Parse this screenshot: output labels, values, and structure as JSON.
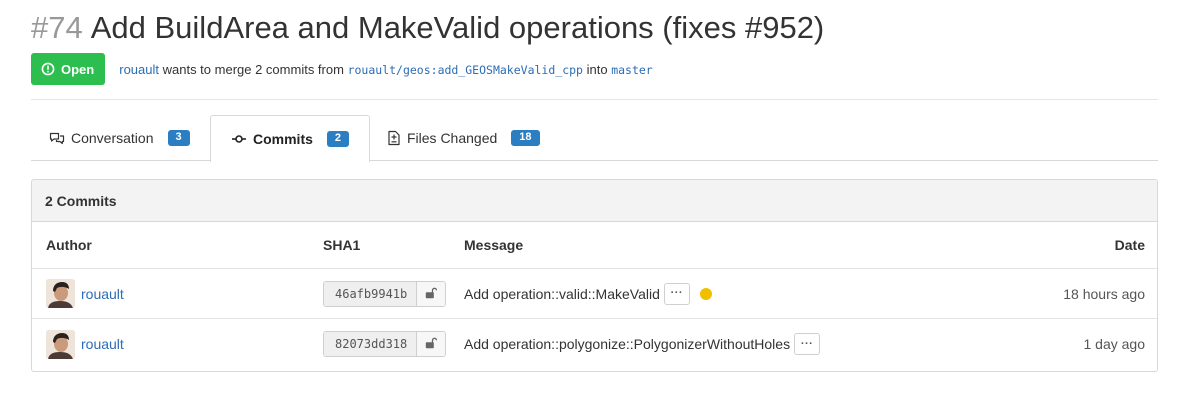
{
  "pr": {
    "number": "#74",
    "title": "Add BuildArea and MakeValid operations (fixes #952)",
    "state_label": "Open",
    "author": "rouault",
    "merge_text_1": "wants to merge 2 commits from",
    "source_branch": "rouault/geos:add_GEOSMakeValid_cpp",
    "merge_text_2": "into",
    "target_branch": "master"
  },
  "tabs": [
    {
      "label": "Conversation",
      "count": "3",
      "icon": "comment-icon",
      "active": false
    },
    {
      "label": "Commits",
      "count": "2",
      "icon": "commit-icon",
      "active": true
    },
    {
      "label": "Files Changed",
      "count": "18",
      "icon": "file-diff-icon",
      "active": false
    }
  ],
  "commits": {
    "heading": "2 Commits",
    "columns": {
      "author": "Author",
      "sha": "SHA1",
      "message": "Message",
      "date": "Date"
    },
    "rows": [
      {
        "author": "rouault",
        "sha": "46afb9941b",
        "message": "Add operation::valid::MakeValid",
        "ellipsis": "···",
        "date": "18 hours ago",
        "status": "pending"
      },
      {
        "author": "rouault",
        "sha": "82073dd318",
        "message": "Add operation::polygonize::PolygonizerWithoutHoles",
        "ellipsis": "···",
        "date": "1 day ago",
        "status": null
      }
    ]
  },
  "colors": {
    "open_state": "#2cbe4e",
    "link": "#2b6db7",
    "counter": "#2b7ec1",
    "status_pending": "#f0c000"
  }
}
